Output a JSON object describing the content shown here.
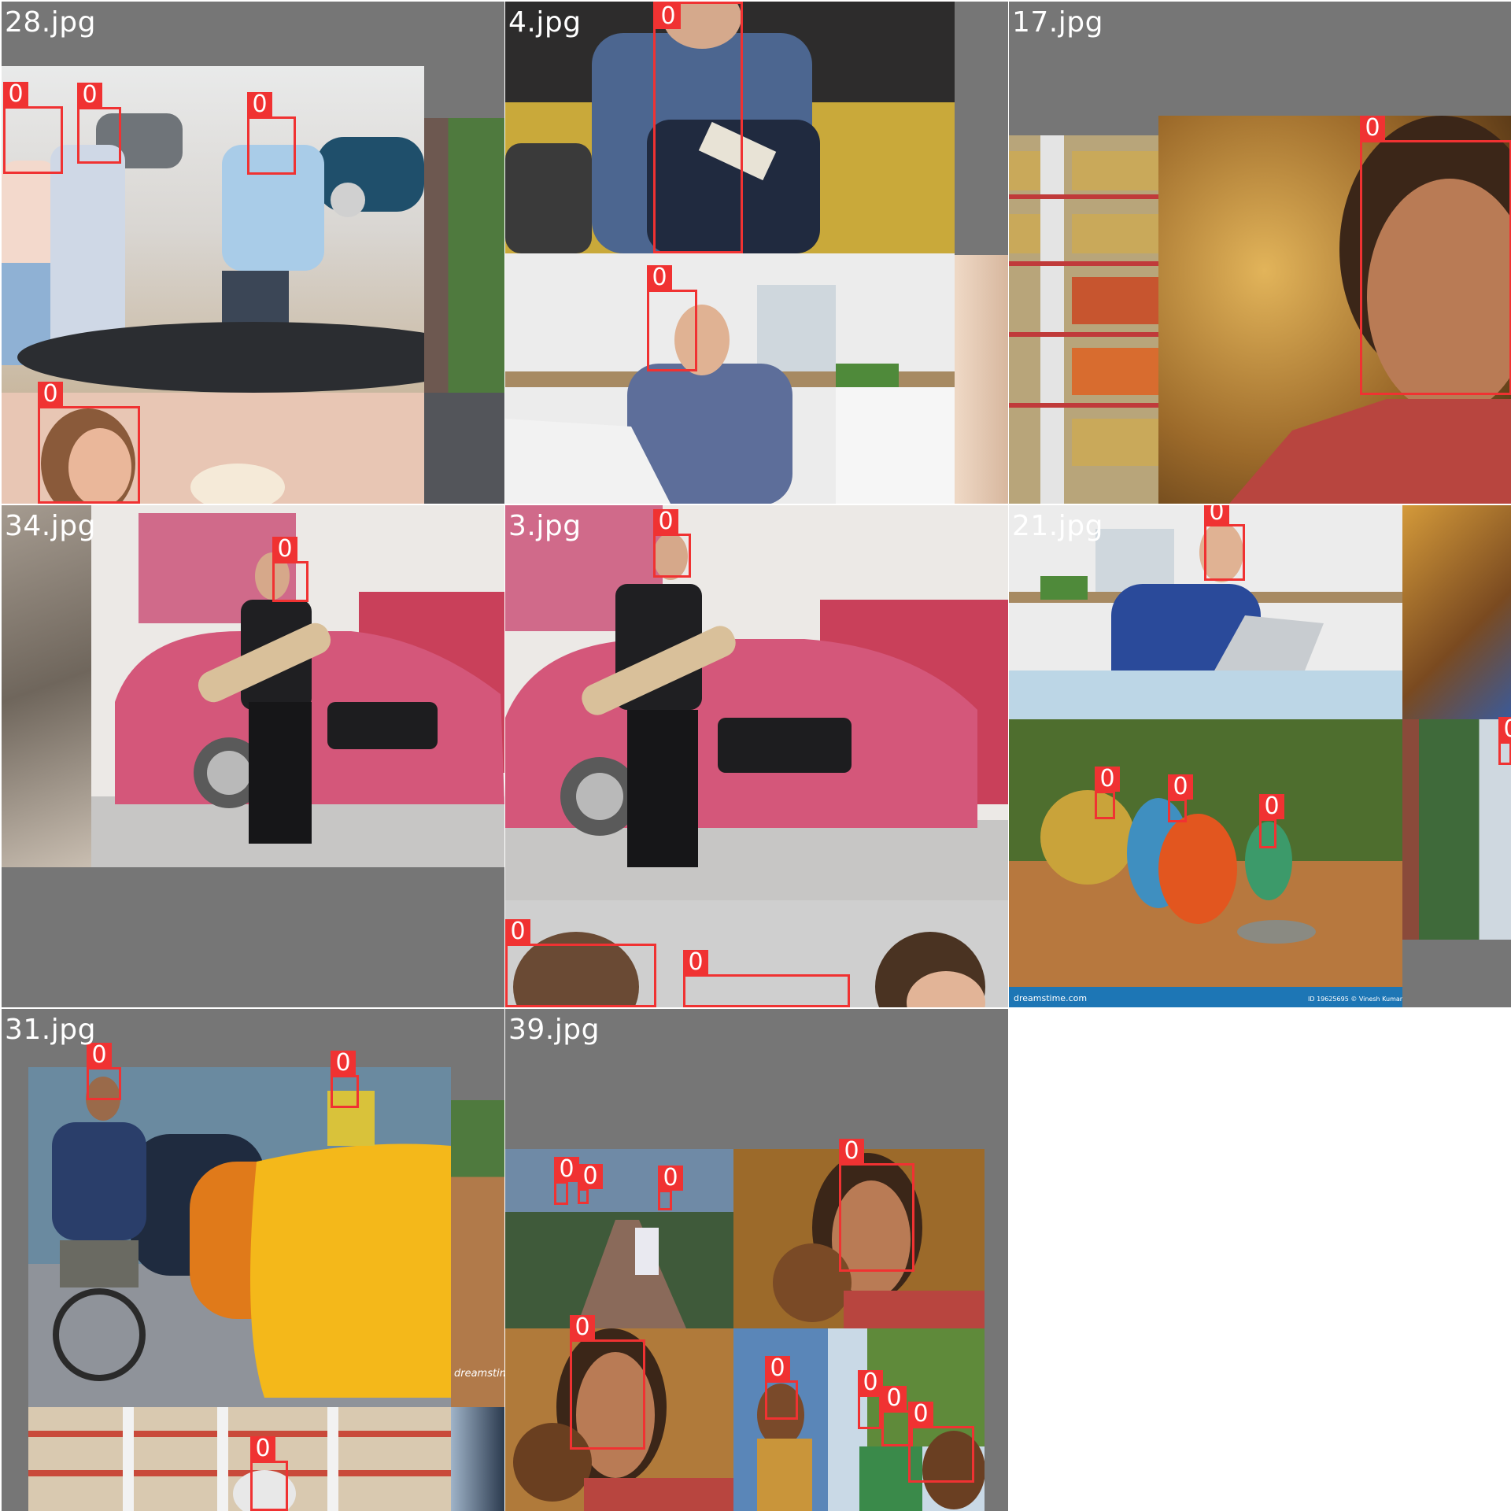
{
  "grid": {
    "tiles": [
      {
        "title": "28.jpg"
      },
      {
        "title": "4.jpg"
      },
      {
        "title": "17.jpg"
      },
      {
        "title": "34.jpg"
      },
      {
        "title": "3.jpg"
      },
      {
        "title": "21.jpg"
      },
      {
        "title": "31.jpg"
      },
      {
        "title": "39.jpg"
      }
    ]
  },
  "box_label": "0",
  "box_color": "#f03232",
  "tile_background": "#767676",
  "watermarks": {
    "dreamstime_left": "dreamstime.com",
    "dreamstime_right": "ID 19625695 © Vinesh Kumar",
    "dreamstime_tile31": "dreamstime"
  }
}
